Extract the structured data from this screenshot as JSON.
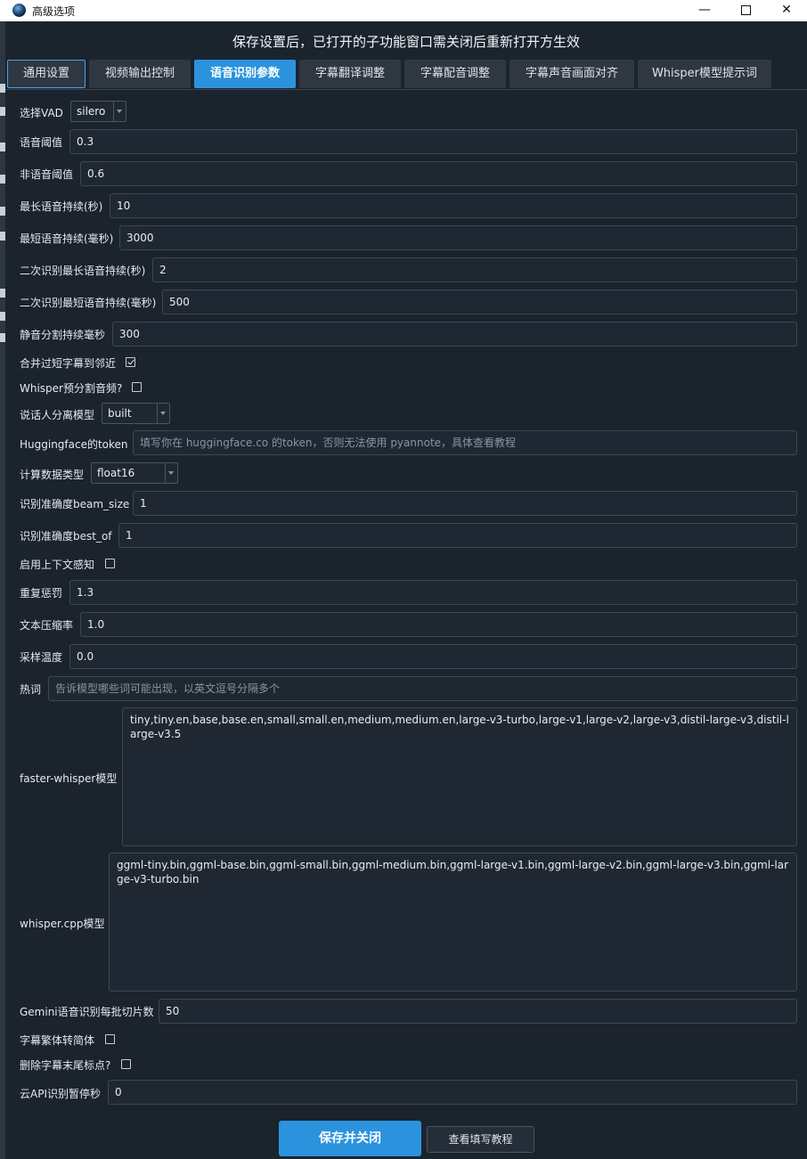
{
  "window": {
    "title": "高级选项",
    "minimize_glyph": "—",
    "close_glyph": "✕"
  },
  "notice": "保存设置后，已打开的子功能窗口需关闭后重新打开方生效",
  "tabs": [
    {
      "label": "通用设置"
    },
    {
      "label": "视频输出控制"
    },
    {
      "label": "语音识别参数"
    },
    {
      "label": "字幕翻译调整"
    },
    {
      "label": "字幕配音调整"
    },
    {
      "label": "字幕声音画面对齐"
    },
    {
      "label": "Whisper模型提示词"
    }
  ],
  "form": {
    "vad": {
      "label": "选择VAD",
      "value": "silero"
    },
    "speech_threshold": {
      "label": "语音阈值",
      "value": "0.3"
    },
    "nonspeech_threshold": {
      "label": "非语音阈值",
      "value": "0.6"
    },
    "max_speech": {
      "label": "最长语音持续(秒)",
      "value": "10"
    },
    "min_speech": {
      "label": "最短语音持续(毫秒)",
      "value": "3000"
    },
    "second_max": {
      "label": "二次识别最长语音持续(秒)",
      "value": "2"
    },
    "second_min": {
      "label": "二次识别最短语音持续(毫秒)",
      "value": "500"
    },
    "silence_split": {
      "label": "静音分割持续毫秒",
      "value": "300"
    },
    "merge_short": {
      "label": "合并过短字幕到邻近",
      "checked": true
    },
    "whisper_presplit": {
      "label": "Whisper预分割音频?",
      "checked": false
    },
    "diarization": {
      "label": "说话人分离模型",
      "value": "built"
    },
    "hf_token": {
      "label": "Huggingface的token",
      "value": "",
      "placeholder": "填写你在 huggingface.co 的token，否则无法使用 pyannote，具体查看教程"
    },
    "compute_type": {
      "label": "计算数据类型",
      "value": "float16"
    },
    "beam_size": {
      "label": "识别准确度beam_size",
      "value": "1"
    },
    "best_of": {
      "label": "识别准确度best_of",
      "value": "1"
    },
    "context": {
      "label": "启用上下文感知",
      "checked": false
    },
    "repetition_penalty": {
      "label": "重复惩罚",
      "value": "1.3"
    },
    "compression_ratio": {
      "label": "文本压缩率",
      "value": "1.0"
    },
    "temperature": {
      "label": "采样温度",
      "value": "0.0"
    },
    "hotwords": {
      "label": "热词",
      "value": "",
      "placeholder": "告诉模型哪些词可能出现，以英文逗号分隔多个"
    },
    "faster_whisper_models": {
      "label": "faster-whisper模型",
      "value": "tiny,tiny.en,base,base.en,small,small.en,medium,medium.en,large-v3-turbo,large-v1,large-v2,large-v3,distil-large-v3,distil-large-v3.5"
    },
    "whisper_cpp_models": {
      "label": "whisper.cpp模型",
      "value": "ggml-tiny.bin,ggml-base.bin,ggml-small.bin,ggml-medium.bin,ggml-large-v1.bin,ggml-large-v2.bin,ggml-large-v3.bin,ggml-large-v3-turbo.bin"
    },
    "gemini_batch": {
      "label": "Gemini语音识别每批切片数",
      "value": "50"
    },
    "traditional_to_simplified": {
      "label": "字幕繁体转简体",
      "checked": false
    },
    "remove_trailing_punct": {
      "label": "删除字幕末尾标点?",
      "checked": false
    },
    "cloud_pause": {
      "label": "云API识别暂停秒",
      "value": "0"
    }
  },
  "buttons": {
    "save": "保存并关闭",
    "help": "查看填写教程"
  }
}
